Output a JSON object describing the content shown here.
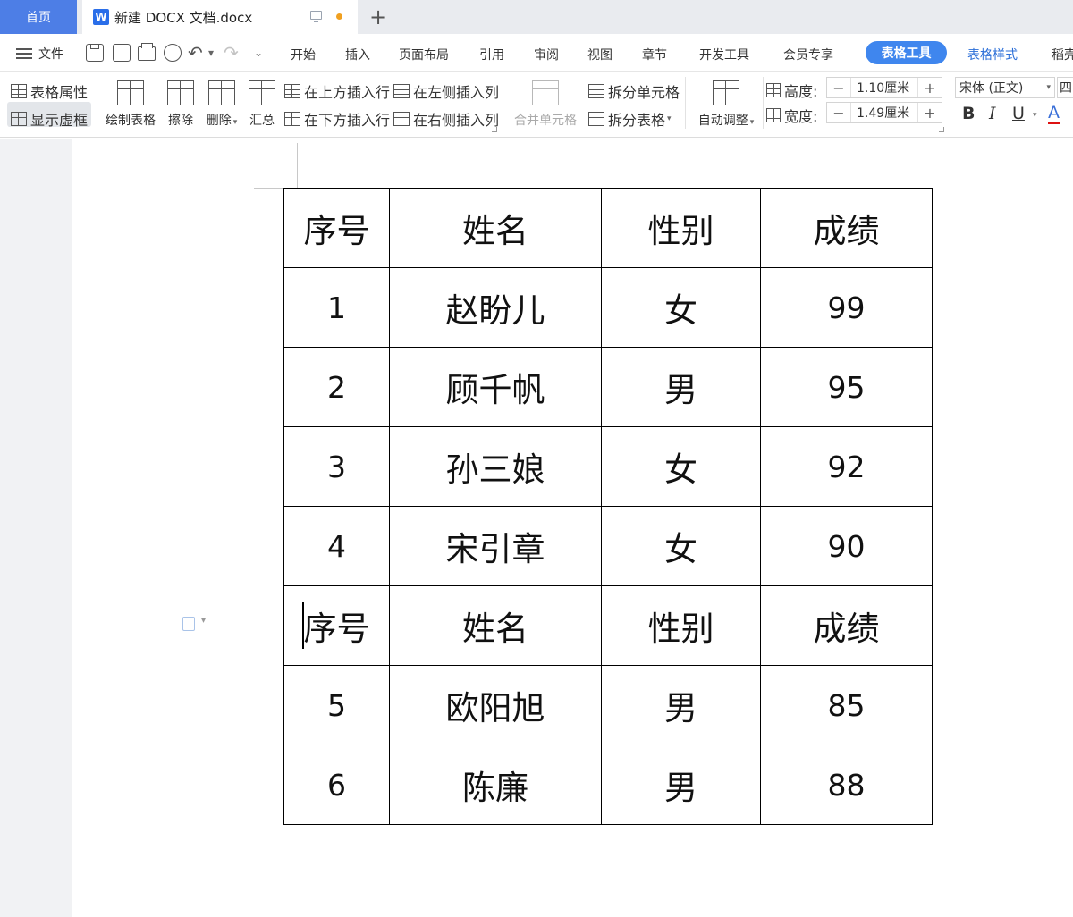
{
  "titlebar": {
    "home_tab": "首页",
    "doc_tab": "新建 DOCX 文档.docx",
    "new_tab_symbol": "+"
  },
  "menu": {
    "file": "文件",
    "items": [
      "开始",
      "插入",
      "页面布局",
      "引用",
      "审阅",
      "视图",
      "章节",
      "开发工具",
      "会员专享",
      "表格工具",
      "表格样式",
      "稻壳"
    ],
    "active": "表格工具"
  },
  "ribbon": {
    "table_props": "表格属性",
    "show_gridlines": "显示虚框",
    "draw_table": "绘制表格",
    "erase": "擦除",
    "delete": "删除",
    "summary": "汇总",
    "insert_above": "在上方插入行",
    "insert_below": "在下方插入行",
    "insert_left": "在左侧插入列",
    "insert_right": "在右侧插入列",
    "merge_cells": "合并单元格",
    "split_cells": "拆分单元格",
    "split_table": "拆分表格",
    "auto_fit": "自动调整",
    "height_label": "高度:",
    "height_value": "1.10厘米",
    "width_label": "宽度:",
    "width_value": "1.49厘米",
    "font_name": "宋体 (正文)",
    "font_size": "四",
    "bold": "B",
    "italic": "I",
    "underline": "U",
    "font_color": "A"
  },
  "table": {
    "rows": [
      [
        "序号",
        "姓名",
        "性别",
        "成绩"
      ],
      [
        "1",
        "赵盼儿",
        "女",
        "99"
      ],
      [
        "2",
        "顾千帆",
        "男",
        "95"
      ],
      [
        "3",
        "孙三娘",
        "女",
        "92"
      ],
      [
        "4",
        "宋引章",
        "女",
        "90"
      ],
      [
        "序号",
        "姓名",
        "性别",
        "成绩"
      ],
      [
        "5",
        "欧阳旭",
        "男",
        "85"
      ],
      [
        "6",
        "陈廉",
        "男",
        "88"
      ]
    ]
  },
  "colors": {
    "accent": "#3f86ee",
    "home_tab": "#4d7ee6",
    "workspace": "#f1f2f4"
  }
}
